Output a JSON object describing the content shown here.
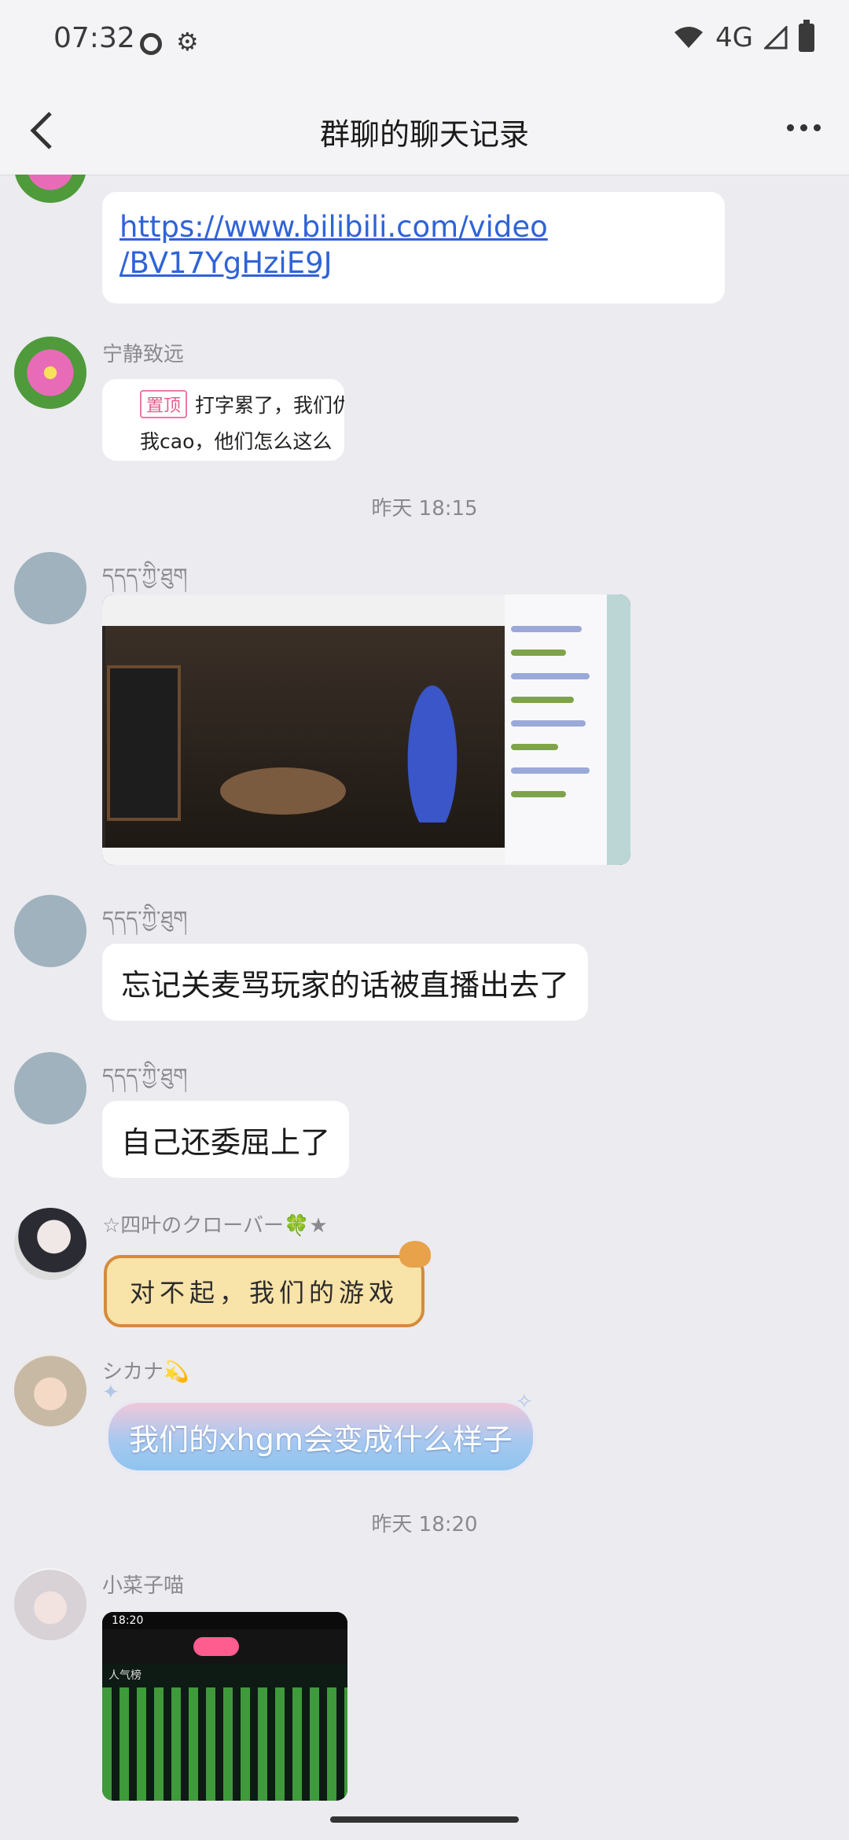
{
  "status_bar": {
    "time": "07:32",
    "network": "4G"
  },
  "nav": {
    "title": "群聊的聊天记录"
  },
  "messages": {
    "m1": {
      "link_line1": "https://www.bilibili.com/video",
      "link_line2": "/BV17YgHziE9J"
    },
    "m2": {
      "sender": "宁静致远",
      "pin_tag": "置顶",
      "quote_line1": "打字累了，我们仇",
      "quote_line2": "我cao，他们怎么这么"
    },
    "time1": "昨天 18:15",
    "m3": {
      "sender": "དདད་ཀྱི་ཐུག"
    },
    "m4": {
      "sender": "དདད་ཀྱི་ཐུག",
      "text": "忘记关麦骂玩家的话被直播出去了"
    },
    "m5": {
      "sender": "དདད་ཀྱི་ཐུག",
      "text": "自己还委屈上了"
    },
    "m6": {
      "sender": "☆四叶のクローバー🍀★",
      "sticker_text": "对不起，我们的游戏"
    },
    "m7": {
      "sender": "シカナ💫",
      "text": "我们的xhgm会变成什么样子"
    },
    "time2": "昨天 18:20",
    "m8": {
      "sender": "小菜子喵",
      "shot_time": "18:20",
      "shot_rank": "人气榜"
    }
  }
}
